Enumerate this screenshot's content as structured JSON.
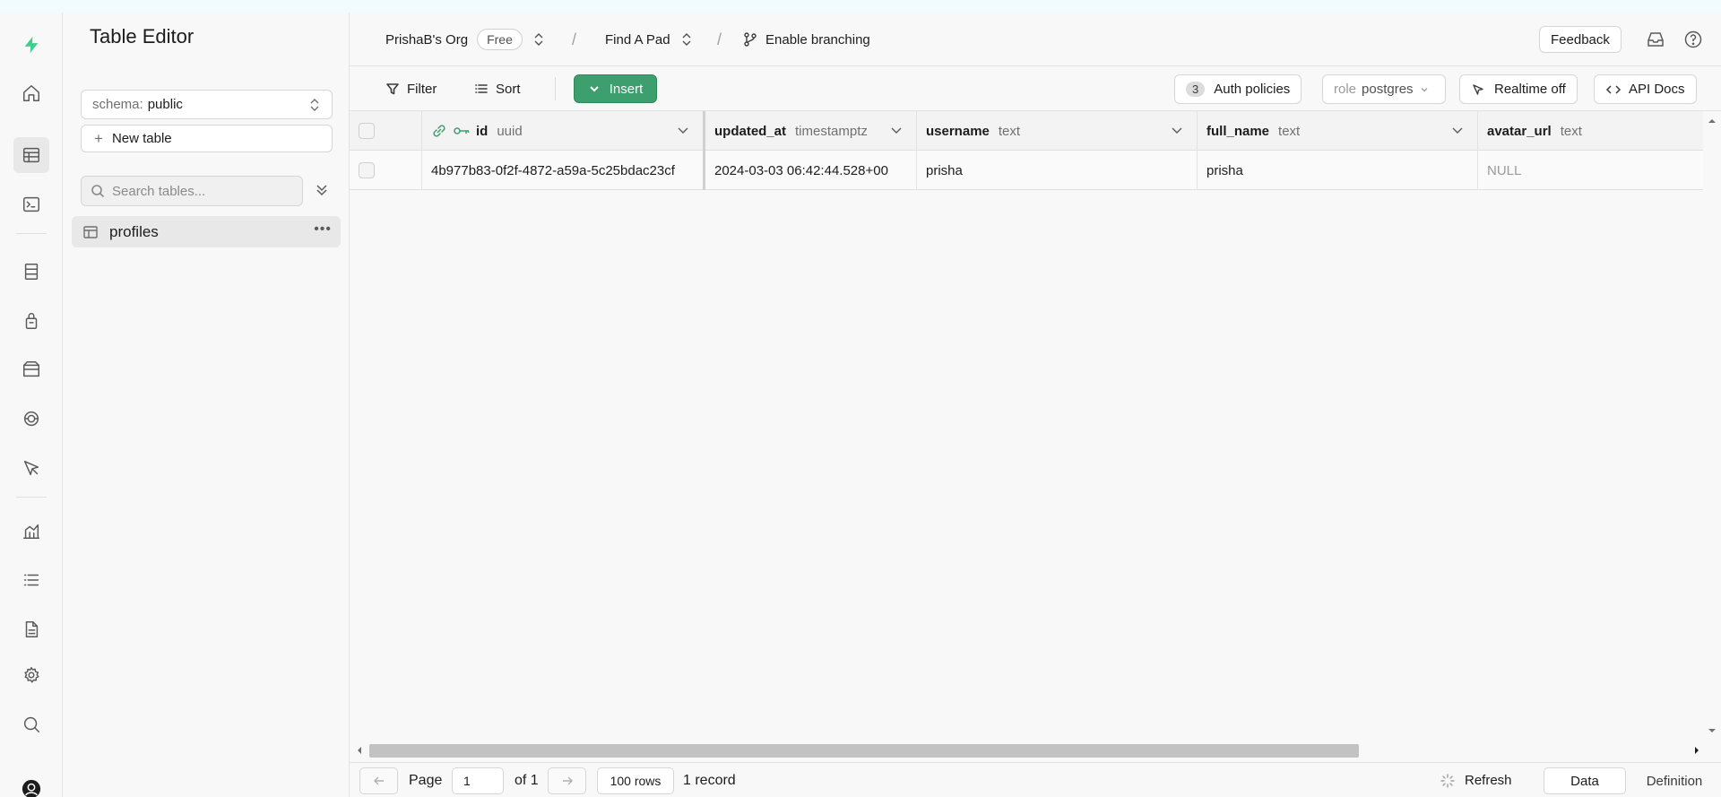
{
  "app": {
    "title": "Table Editor"
  },
  "rail": {
    "icons": [
      "supabase-logo-icon",
      "home-icon",
      "table-editor-icon",
      "sql-editor-icon",
      "database-icon",
      "authentication-icon",
      "storage-icon",
      "edge-functions-icon",
      "realtime-icon",
      "reports-icon",
      "logs-icon",
      "api-docs-icon",
      "settings-icon",
      "search-icon",
      "account-icon"
    ],
    "accent": "#3ecf8e"
  },
  "sidebar": {
    "schema_label": "schema:",
    "schema_value": "public",
    "new_table_label": "New table",
    "search_placeholder": "Search tables...",
    "tables": [
      {
        "name": "profiles"
      }
    ]
  },
  "header": {
    "org": "PrishaB's Org",
    "plan_badge": "Free",
    "project": "Find A Pad",
    "branching_label": "Enable branching",
    "feedback_label": "Feedback"
  },
  "toolbar": {
    "filter_label": "Filter",
    "sort_label": "Sort",
    "insert_label": "Insert",
    "auth_policies_count": "3",
    "auth_policies_label": "Auth policies",
    "role_label": "role",
    "role_value": "postgres",
    "realtime_label": "Realtime off",
    "api_docs_label": "API Docs",
    "insert_color": "#3e9f6e"
  },
  "grid": {
    "columns": [
      {
        "name": "id",
        "type": "uuid"
      },
      {
        "name": "updated_at",
        "type": "timestamptz"
      },
      {
        "name": "username",
        "type": "text"
      },
      {
        "name": "full_name",
        "type": "text"
      },
      {
        "name": "avatar_url",
        "type": "text"
      }
    ],
    "rows": [
      [
        "4b977b83-0f2f-4872-a59a-5c25bdac23cf",
        "2024-03-03 06:42:44.528+00",
        "prisha",
        "prisha",
        "NULL"
      ]
    ]
  },
  "footer": {
    "page_label": "Page",
    "page_value": "1",
    "of_label": "of 1",
    "rows_label": "100 rows",
    "records_label": "1 record",
    "refresh_label": "Refresh",
    "data_tab": "Data",
    "definition_tab": "Definition"
  }
}
